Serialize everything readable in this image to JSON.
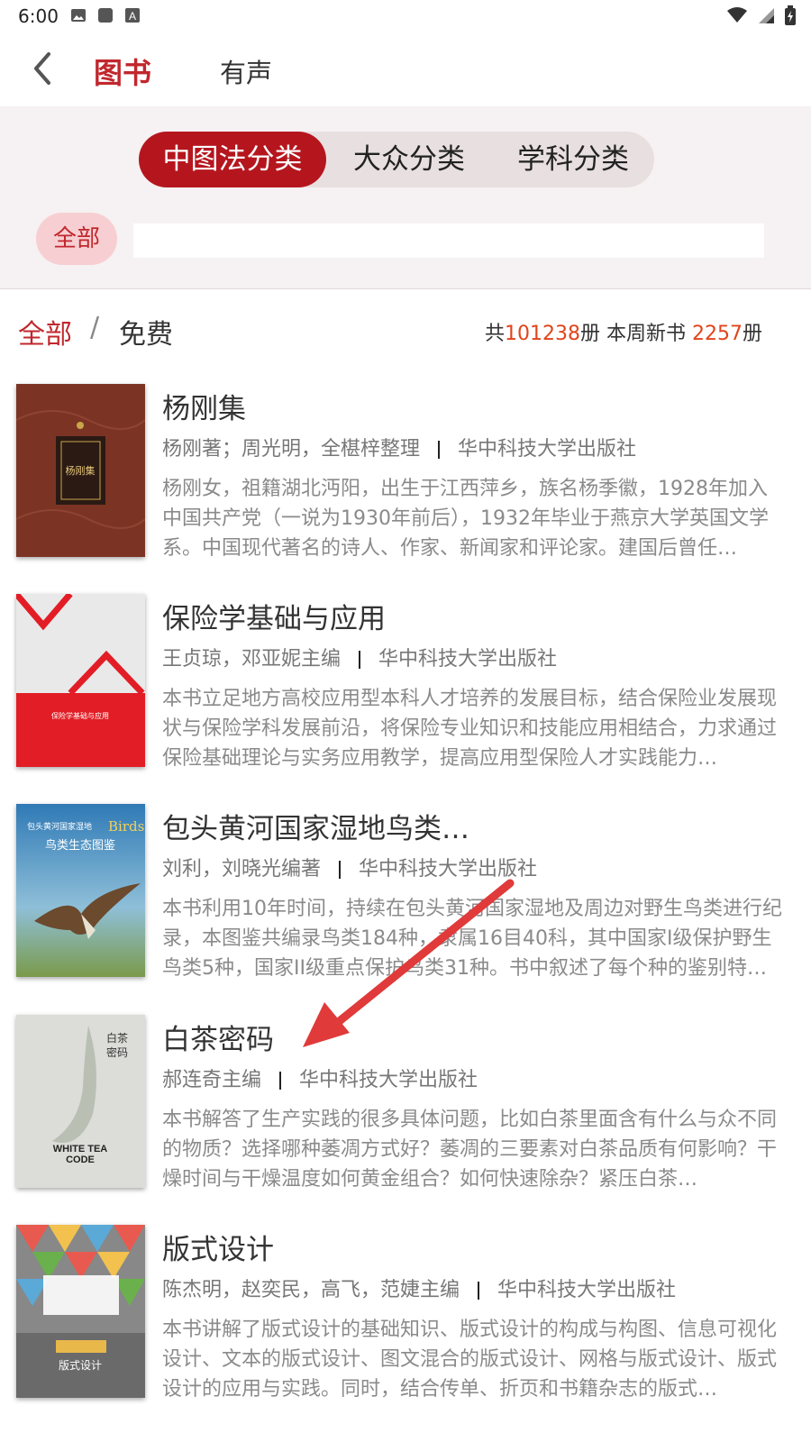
{
  "status_bar": {
    "time": "6:00",
    "icons_left": [
      "image-icon",
      "square-icon",
      "a-icon"
    ],
    "icons_right": [
      "wifi-icon",
      "signal-icon",
      "battery-icon"
    ]
  },
  "nav": {
    "back": "back-icon",
    "tabs": [
      "图书",
      "有声"
    ],
    "active_tab": "图书"
  },
  "filter": {
    "segments": [
      "中图法分类",
      "大众分类",
      "学科分类"
    ],
    "active_segment": "中图法分类",
    "chip": "全部"
  },
  "summary": {
    "crumb_all": "全部",
    "crumb_sep": "/",
    "crumb_free": "免费",
    "total_prefix": "共",
    "total_count": "101238",
    "total_suffix": "册 本周新书 ",
    "new_count": "2257",
    "new_suffix": "册"
  },
  "books": [
    {
      "title": "杨刚集",
      "authors": "杨刚著；周光明，全椹梓整理",
      "publisher": "华中科技大学出版社",
      "desc": "杨刚女，祖籍湖北沔阳，出生于江西萍乡，族名杨季徽，1928年加入中国共产党（一说为1930年前后），1932年毕业于燕京大学英国文学系。中国现代著名的诗人、作家、新闻家和评论家。建国后曾任…",
      "cover_color": "#7a3526"
    },
    {
      "title": "保险学基础与应用",
      "authors": "王贞琼，邓亚妮主编",
      "publisher": "华中科技大学出版社",
      "desc": "本书立足地方高校应用型本科人才培养的发展目标，结合保险业发展现状与保险学科发展前沿，将保险专业知识和技能应用相结合，力求通过保险基础理论与实务应用教学，提高应用型保险人才实践能力…",
      "cover_color": "#e21d25"
    },
    {
      "title": "包头黄河国家湿地鸟类生…",
      "authors": "刘利，刘晓光编著",
      "publisher": "华中科技大学出版社",
      "desc": "本书利用10年时间，持续在包头黄河国家湿地及周边对野生鸟类进行纪录，本图鉴共编录鸟类184种，隶属16目40科，其中国家I级保护野生鸟类5种，国家II级重点保护鸟类31种。书中叙述了每个种的鉴别特…",
      "cover_color": "#3d7fb0"
    },
    {
      "title": "白茶密码",
      "authors": "郝连奇主编",
      "publisher": "华中科技大学出版社",
      "desc": "本书解答了生产实践的很多具体问题，比如白茶里面含有什么与众不同的物质？选择哪种萎凋方式好？萎凋的三要素对白茶品质有何影响？干燥时间与干燥温度如何黄金组合？如何快速除杂？紧压白茶…",
      "cover_color": "#d9d9d6"
    },
    {
      "title": "版式设计",
      "authors": "陈杰明，赵奕民，高飞，范婕主编",
      "publisher": "华中科技大学出版社",
      "desc": "本书讲解了版式设计的基础知识、版式设计的构成与构图、信息可视化设计、文本的版式设计、图文混合的版式设计、网格与版式设计、版式设计的应用与实践。同时，结合传单、折页和书籍杂志的版式…",
      "cover_color": "#8c8c8c"
    }
  ],
  "covers": {
    "c1_text": "杨刚集",
    "c3_text_a": "包头黄河国家湿地",
    "c3_text_b": "Birds",
    "c3_text_c": "鸟类生态图鉴",
    "c4_text_a": "白茶",
    "c4_text_b": "密码",
    "c4_text_c": "WHITE TEA",
    "c4_text_d": "CODE",
    "c5_text": "版式设计",
    "c2_text": "保险学基础与应用"
  },
  "annotation": {
    "arrow_color": "#e03a3a"
  }
}
